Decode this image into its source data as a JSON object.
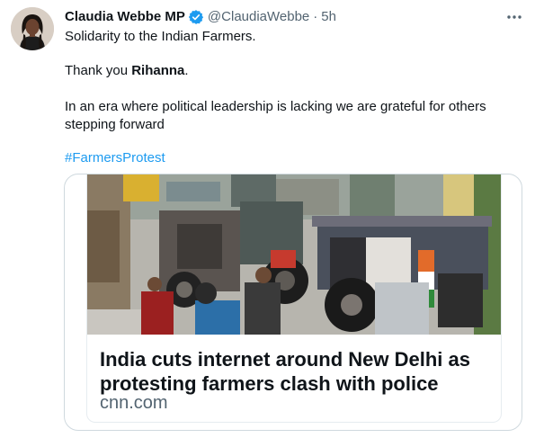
{
  "tweet": {
    "author_name": "Claudia Webbe MP",
    "author_handle": "@ClaudiaWebbe",
    "separator": "·",
    "time_ago": "5h",
    "lines": {
      "line1": "Solidarity to the Indian Farmers.",
      "line2_prefix": "Thank you ",
      "line2_bold": "Rihanna",
      "line2_suffix": ".",
      "line3a": "In an era where political leadership is lacking we are grateful for others",
      "line3b": "stepping forward",
      "hashtag": "#FarmersProtest"
    }
  },
  "card": {
    "headline": "India cuts internet around New Delhi as protesting farmers clash with police",
    "domain": "cnn.com"
  },
  "icons": {
    "verified": "verified-badge-icon",
    "more": "more-options-icon"
  },
  "colors": {
    "link_blue": "#1d9bf0",
    "secondary_text": "#536471",
    "primary_text": "#0f1419",
    "border": "#cfd9de"
  }
}
